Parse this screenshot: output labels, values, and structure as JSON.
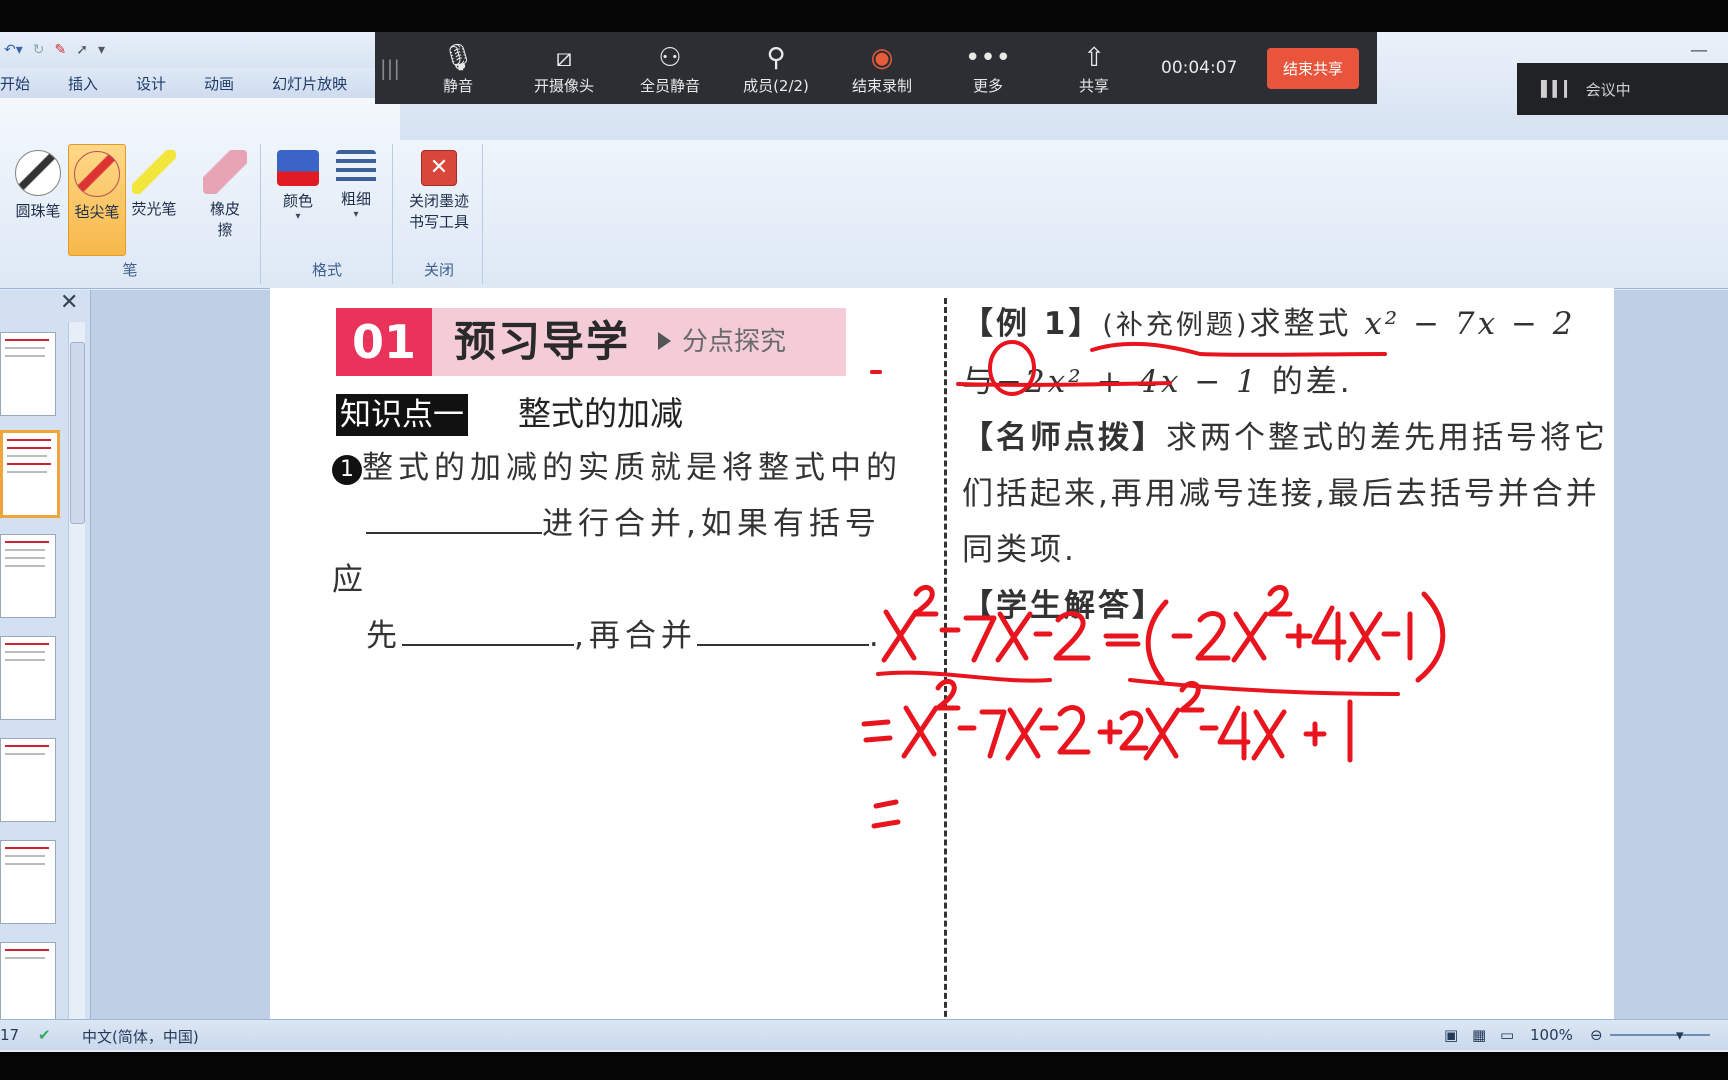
{
  "qat": {
    "icons": [
      "undo-icon",
      "redo-icon",
      "ink-icon",
      "pointer-icon",
      "customize-icon"
    ]
  },
  "tabs": [
    "开始",
    "插入",
    "设计",
    "动画",
    "幻灯片放映"
  ],
  "ribbon": {
    "pen_group": {
      "label": "笔",
      "tools": [
        "圆珠笔",
        "毡尖笔",
        "荧光笔",
        "橡皮擦"
      ]
    },
    "format_group": {
      "label": "格式",
      "tools": [
        "颜色",
        "粗细"
      ]
    },
    "close_group": {
      "label": "关闭",
      "tool_line1": "关闭墨迹",
      "tool_line2": "书写工具"
    }
  },
  "meeting": {
    "buttons": [
      "静音",
      "开摄像头",
      "全员静音",
      "成员(2/2)",
      "结束录制",
      "更多",
      "共享"
    ],
    "timer": "00:04:07",
    "end_share": "结束共享",
    "status": "会议中"
  },
  "slide": {
    "badge_num": "01",
    "badge_title": "预习导学",
    "badge_sub": "分点探究",
    "kp_tag": "知识点一",
    "kp_title": "整式的加减",
    "p1_num": "1",
    "p1_a": "整式的加减的实质就是将整式中的",
    "p1_b": "进行合并,如果有括号应",
    "p1_c": "先",
    "p1_d": ",再合并",
    "p1_e": ".",
    "ex_tag": "【例 1】",
    "ex_note": "(补充例题)",
    "ex_text": "求整式",
    "ex_expr1": "x² − 7x − 2",
    "ex_with": "与",
    "ex_expr2": "−2x² + 4x − 1",
    "ex_end": "的差.",
    "tip_tag": "【名师点拨】",
    "tip_text": "求两个整式的差先用括号将它们括起来,再用减号连接,最后去括号并合并同类项.",
    "ans_tag": "【学生解答】"
  },
  "status": {
    "slide": "17",
    "lang": "中文(简体，中国)",
    "zoom": "100%"
  },
  "colors": {
    "ink": "#e8141e",
    "badge": "#e9335a",
    "end_share": "#e9553c"
  }
}
